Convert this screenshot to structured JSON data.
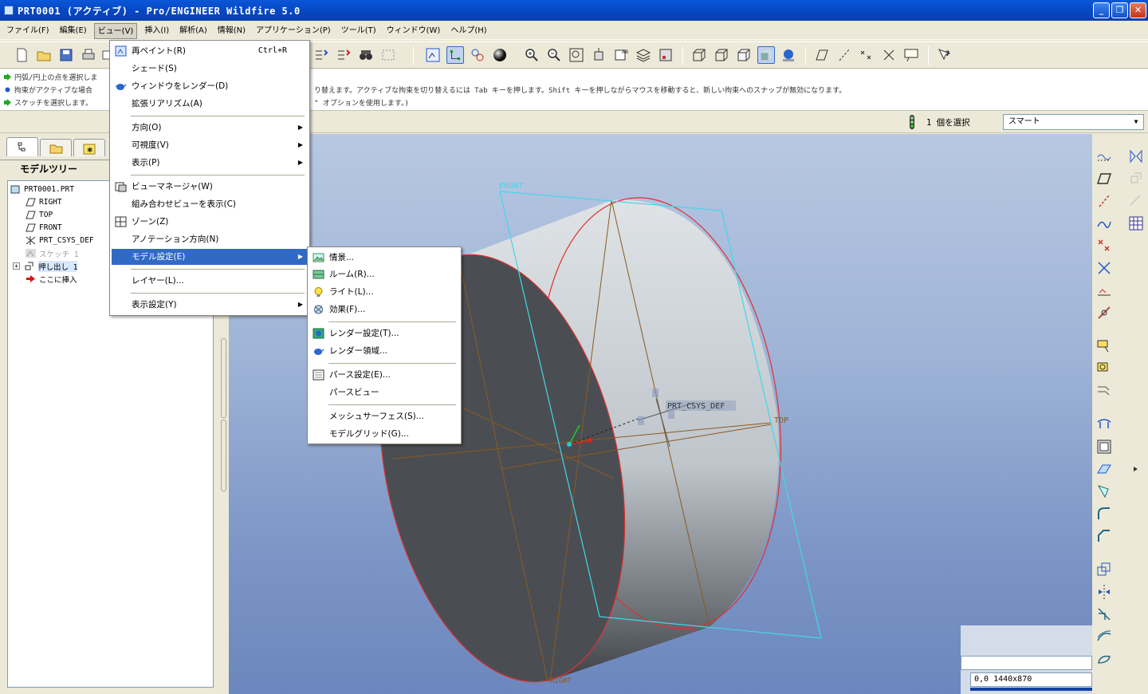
{
  "window": {
    "title": "PRT0001 (アクティブ) - Pro/ENGINEER Wildfire 5.0"
  },
  "menubar": {
    "items": [
      "ファイル(F)",
      "編集(E)",
      "ビュー(V)",
      "挿入(I)",
      "解析(A)",
      "情報(N)",
      "アプリケーション(P)",
      "ツール(T)",
      "ウィンドウ(W)",
      "ヘルプ(H)"
    ]
  },
  "messages": {
    "line1": "円弧/円上の点を選択しま",
    "line2": "拘束がアクティブな場合",
    "line3": "スケッチを選択します。",
    "cont1": "り替えます。アクティブな拘束を切り替えるには Tab キーを押します。Shift キーを押しながらマウスを移動すると、新しい拘束へのスナップが無効になります。",
    "cont2": "\" オプションを使用します。)"
  },
  "selection": {
    "count_label": "1 個を選択",
    "filter": "スマート"
  },
  "tree": {
    "header": "モデルツリー",
    "items": [
      "PRT0001.PRT",
      "RIGHT",
      "TOP",
      "FRONT",
      "PRT_CSYS_DEF",
      "スケッチ 1",
      "押し出し 1",
      "ここに挿入"
    ]
  },
  "view_menu": {
    "items": [
      {
        "label": "再ペイント(R)",
        "shortcut": "Ctrl+R"
      },
      {
        "label": "シェード(S)"
      },
      {
        "label": "ウィンドウをレンダー(D)"
      },
      {
        "label": "拡張リアリズム(A)"
      },
      {
        "label": "方向(O)"
      },
      {
        "label": "可視度(V)"
      },
      {
        "label": "表示(P)"
      },
      {
        "label": "ビューマネージャ(W)"
      },
      {
        "label": "組み合わせビューを表示(C)"
      },
      {
        "label": "ゾーン(Z)"
      },
      {
        "label": "アノテーション方向(N)"
      },
      {
        "label": "モデル設定(E)"
      },
      {
        "label": "レイヤー(L)..."
      },
      {
        "label": "表示設定(Y)"
      }
    ]
  },
  "model_settings_menu": {
    "items": [
      "情景...",
      "ルーム(R)...",
      "ライト(L)...",
      "効果(F)...",
      "レンダー設定(T)...",
      "レンダー領域...",
      "パース設定(E)...",
      "パースビュー",
      "メッシュサーフェス(S)...",
      "モデルグリッド(G)..."
    ]
  },
  "viewport": {
    "labels": {
      "front": "FRONT",
      "top": "TOP",
      "csys": "PRT_CSYS_DEF",
      "bottom": "RIGHT"
    },
    "colors": {
      "edge": "#e03030",
      "datum_plane": "#40d8e8",
      "datum_line": "#8a5a20"
    }
  },
  "coord": {
    "readout": "0,0  1440x870"
  }
}
